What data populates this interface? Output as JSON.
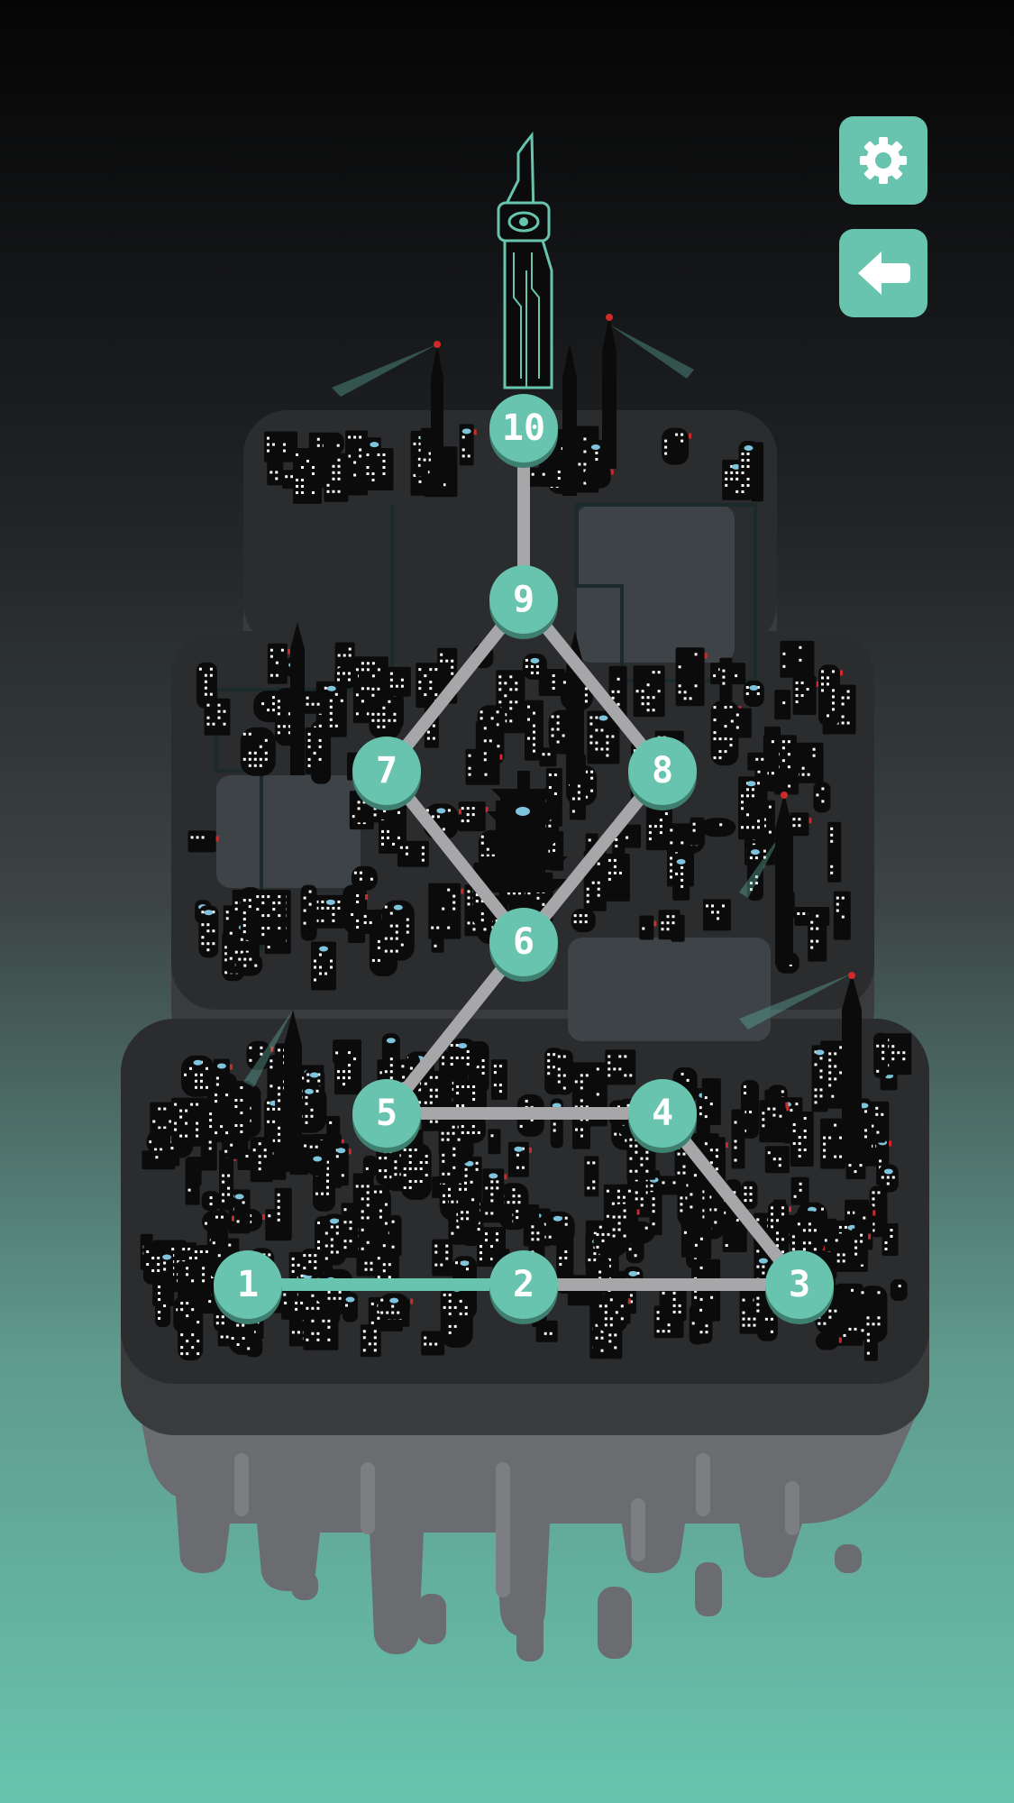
{
  "game": {
    "colors": {
      "accent": "#68c4ae",
      "island": "#3a3b3d",
      "island_edge": "#2b2c2e",
      "underside": "#6b6c70",
      "path": "#a7a7aa",
      "path_active": "#68c4ae",
      "building": "#0b0b0c",
      "window": "#ffffff",
      "eye": "#7ec4dc",
      "beacon": "#cf2a2a"
    },
    "toolbar": {
      "settings_icon": "gear-icon",
      "back_icon": "arrow-left-icon"
    },
    "levels": [
      {
        "label": "1"
      },
      {
        "label": "2"
      },
      {
        "label": "3"
      },
      {
        "label": "4"
      },
      {
        "label": "5"
      },
      {
        "label": "6"
      },
      {
        "label": "7"
      },
      {
        "label": "8"
      },
      {
        "label": "9"
      },
      {
        "label": "10"
      }
    ],
    "landmarks": {
      "tower_icon": "eye-tower-icon",
      "pagoda_icon": "pagoda-icon"
    }
  }
}
